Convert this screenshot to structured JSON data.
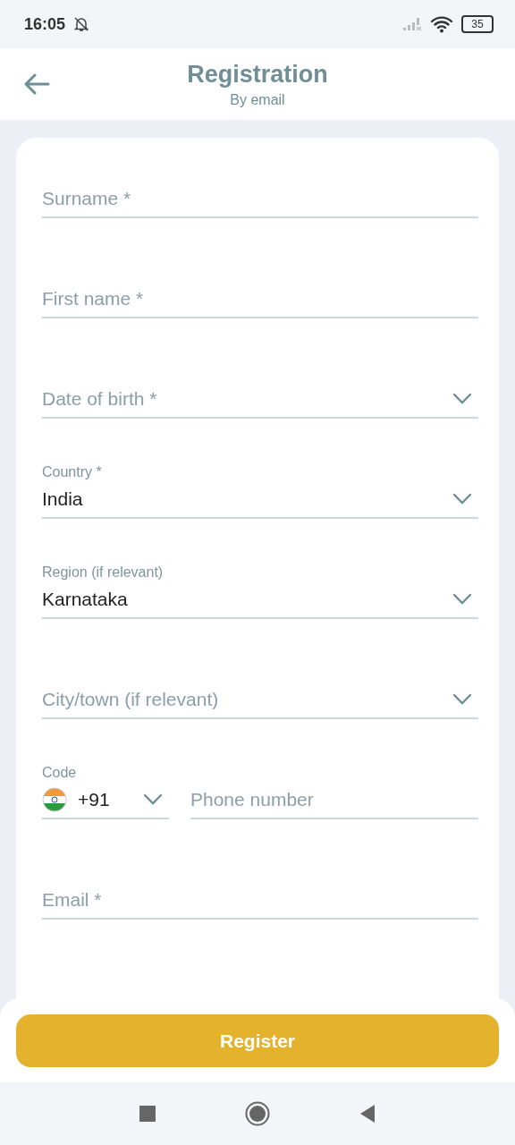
{
  "status_bar": {
    "time": "16:05",
    "battery": "35"
  },
  "header": {
    "title": "Registration",
    "subtitle": "By email"
  },
  "fields": [
    {
      "kind": "text",
      "placeholder": "Surname *"
    },
    {
      "kind": "text",
      "placeholder": "First name *"
    },
    {
      "kind": "select",
      "placeholder": "Date of birth *"
    },
    {
      "kind": "select",
      "label": "Country *",
      "value": "India"
    },
    {
      "kind": "select",
      "label": "Region (if relevant)",
      "value": "Karnataka"
    },
    {
      "kind": "select",
      "placeholder": "City/town (if relevant)"
    },
    {
      "kind": "phone",
      "label": "Code",
      "value": "+91",
      "placeholder": "Phone number"
    },
    {
      "kind": "text",
      "placeholder": "Email *"
    }
  ],
  "register_button": "Register"
}
